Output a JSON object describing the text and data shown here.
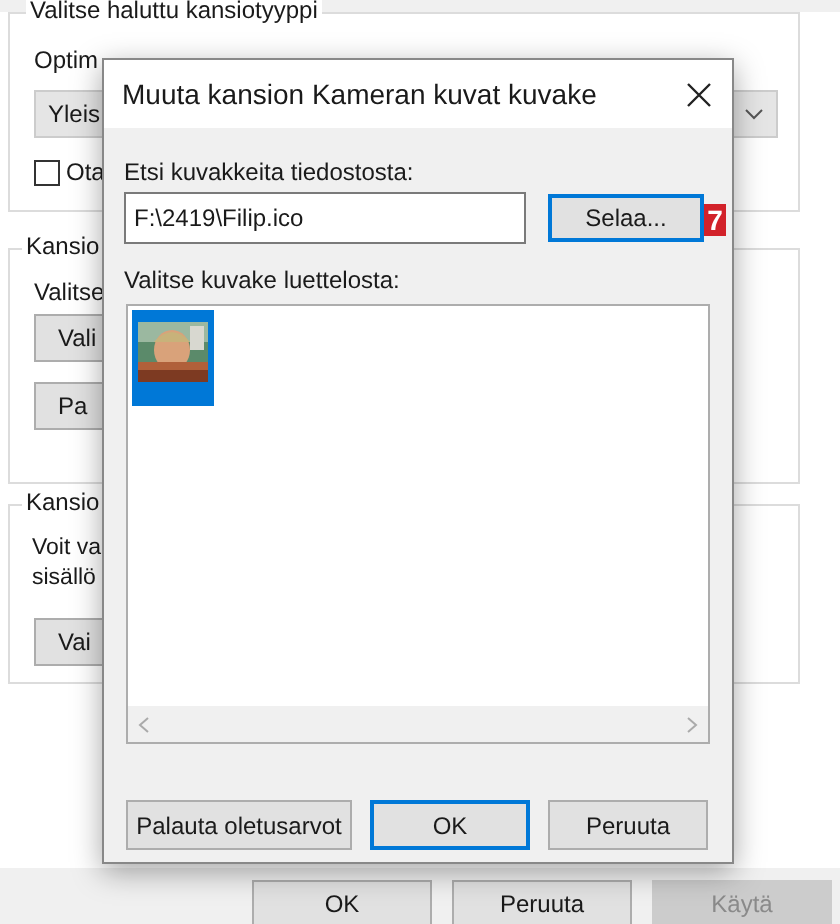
{
  "background_window": {
    "folder_type_group": {
      "title": "Valitse haluttu kansiotyyppi",
      "optimize_label": "Optim",
      "dropdown_value": "Yleis",
      "checkbox": {
        "label": "Ota",
        "checked": false
      }
    },
    "pictures_group": {
      "title": "Kansio",
      "text": "Valitse",
      "buttons": [
        "Vali",
        "Pa"
      ]
    },
    "icons_group": {
      "title": "Kansio",
      "text_lines": [
        "Voit va",
        "sisällö"
      ],
      "buttons": [
        "Vai"
      ]
    },
    "buttons": [
      {
        "label": "OK",
        "disabled": false
      },
      {
        "label": "Peruuta",
        "disabled": false
      },
      {
        "label": "Käytä",
        "disabled": true
      }
    ]
  },
  "dialog": {
    "title": "Muuta kansion Kameran kuvat kuvake",
    "file_label": "Etsi kuvakkeita tiedostosta:",
    "file_value": "F:\\2419\\Filip.ico",
    "browse_button": {
      "label": "Selaa...",
      "focused": true
    },
    "badge": "7",
    "list_label": "Valitse kuvake luettelosta:",
    "icons": [
      {
        "kind": "picture",
        "selected": true
      }
    ],
    "buttons": [
      {
        "label": "Palauta oletusarvot",
        "default": false
      },
      {
        "label": "OK",
        "default": true
      },
      {
        "label": "Peruuta",
        "default": false
      }
    ]
  }
}
